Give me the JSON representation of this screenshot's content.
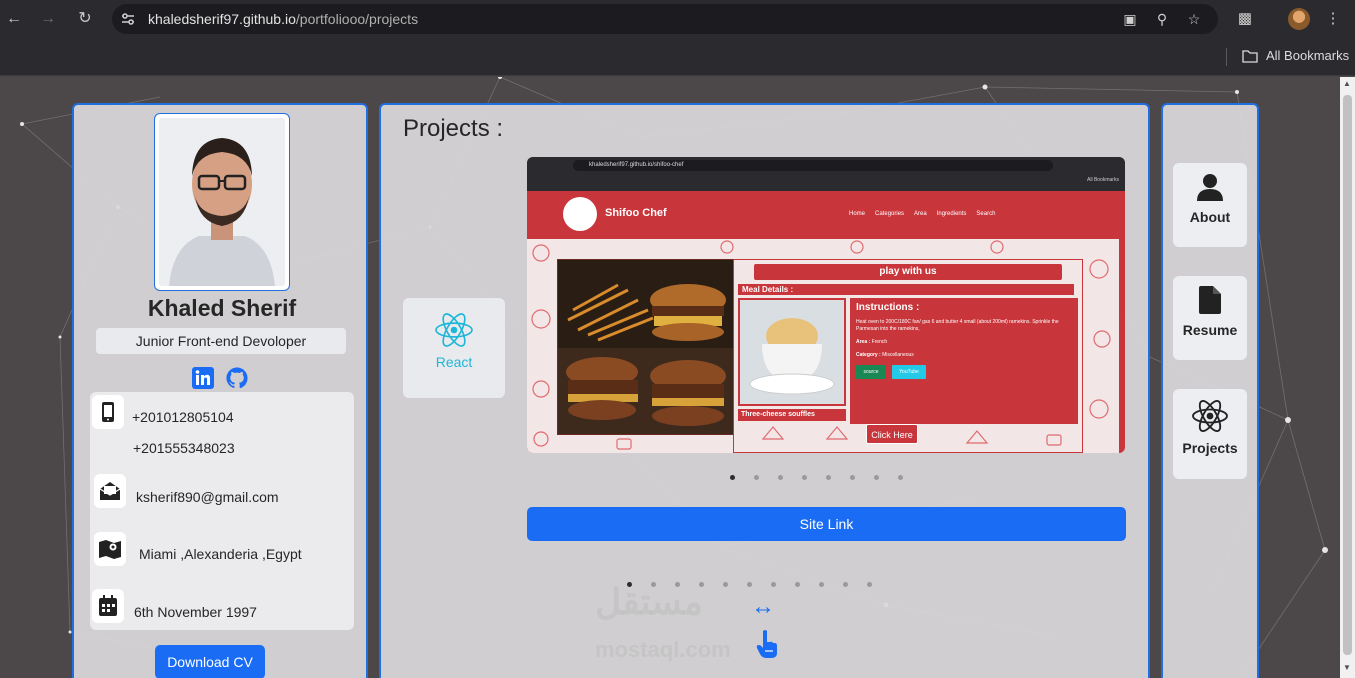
{
  "browser": {
    "url_host": "khaledsherif97.github.io",
    "url_path": "/portfoliooo/projects",
    "bookmarks_label": "All Bookmarks"
  },
  "profile": {
    "name": "Khaled Sherif",
    "role": "Junior Front-end Devoloper",
    "phone1": "+201012805104",
    "phone2": "+201555348023",
    "email": "ksherif890@gmail.com",
    "address": "Miami ,Alexanderia ,Egypt",
    "birthday": "6th November 1997",
    "download_label": "Download CV"
  },
  "projects": {
    "title": "Projects :",
    "tech_label": "React",
    "site_link_label": "Site Link",
    "carousel_dots": 8,
    "project_dots": 11
  },
  "preview": {
    "url": "khaledsherif97.github.io/shifoo-chef",
    "bookmarks": "All Bookmarks",
    "brand": "Shifoo Chef",
    "menu": [
      "Home",
      "Categories",
      "Area",
      "Ingredients",
      "Search"
    ],
    "play": "play with us",
    "meal_details": "Meal Details :",
    "instructions_title": "Instructions :",
    "instructions_text": "Heat oven to 200C/180C fan/ gas 6 and butter 4 small (about 200ml) ramekins. Sprinkle the Parmesan into the ramekins,",
    "area_label": "Area :",
    "area_value": "French",
    "category_label": "Category :",
    "category_value": "Miscellaneous",
    "source_btn": "source",
    "youtube_btn": "YouTube",
    "meal_name": "Three-cheese souffles",
    "click_here": "Click Here"
  },
  "watermark": {
    "arabic": "مستقل",
    "latin": "mostaql.com"
  },
  "nav": {
    "about": "About",
    "resume": "Resume",
    "projects": "Projects"
  },
  "colors": {
    "accent": "#1a6cf5",
    "card_border": "#1f6fe3",
    "react": "#1fb7d8",
    "preview_red": "#c8353a"
  }
}
